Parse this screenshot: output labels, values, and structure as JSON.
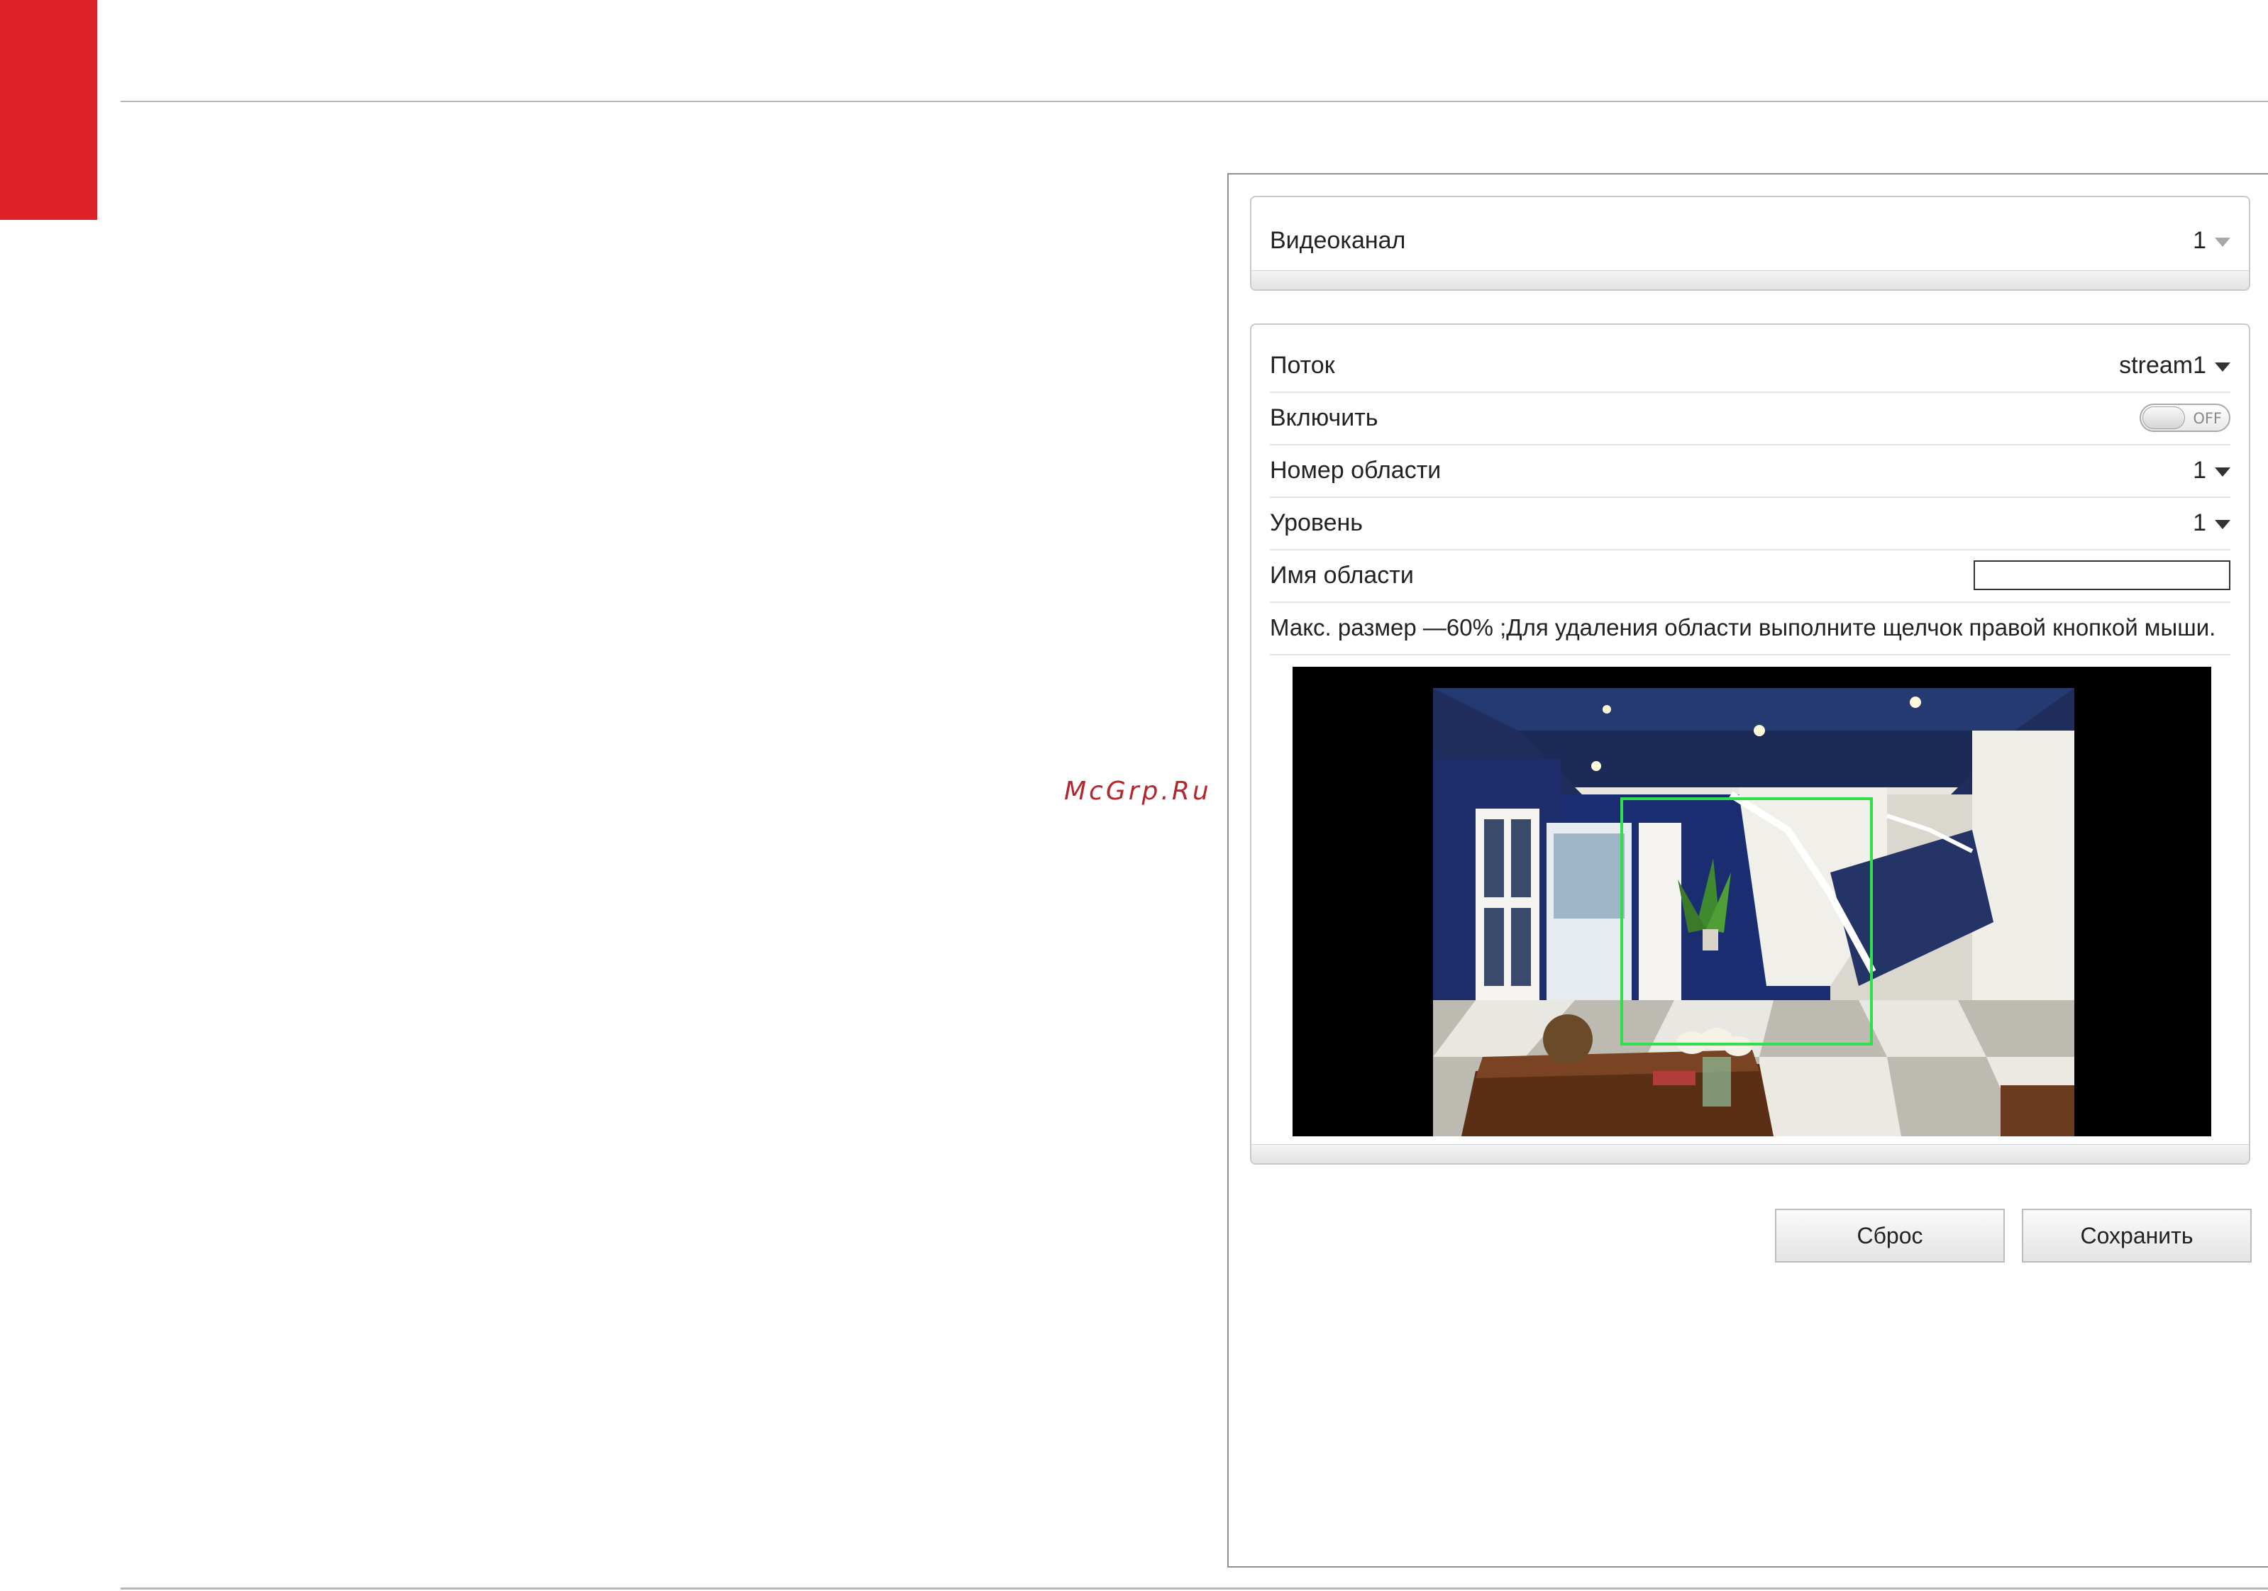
{
  "watermark": "McGrp.Ru",
  "channel_panel": {
    "label": "Видеоканал",
    "value": "1"
  },
  "stream_panel": {
    "stream": {
      "label": "Поток",
      "value": "stream1"
    },
    "enable": {
      "label": "Включить",
      "state": "OFF"
    },
    "area_number": {
      "label": "Номер области",
      "value": "1"
    },
    "level": {
      "label": "Уровень",
      "value": "1"
    },
    "area_name": {
      "label": "Имя области",
      "value": ""
    },
    "note": "Макс. размер —60% ;Для удаления области выполните щелчок правой кнопкой мыши."
  },
  "buttons": {
    "reset": "Сброс",
    "save": "Сохранить"
  },
  "colors": {
    "brand_red": "#dc2129",
    "roi_green": "#2fe04a"
  }
}
